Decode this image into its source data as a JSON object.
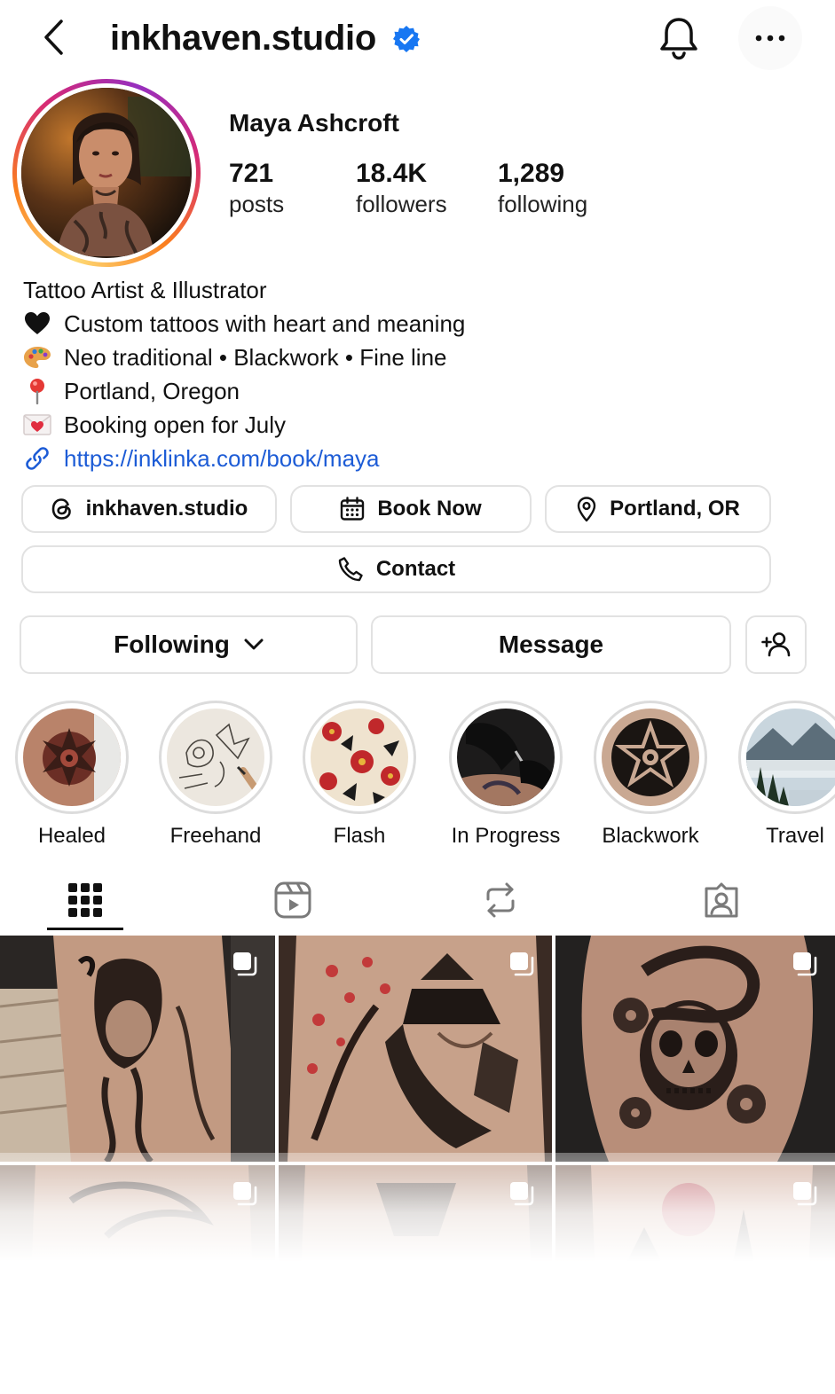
{
  "header": {
    "handle": "inkhaven.studio",
    "verified": true,
    "icons": [
      "back-arrow-icon",
      "verified-badge-icon",
      "bell-icon",
      "more-horizontal-icon"
    ]
  },
  "profile": {
    "display_name": "Maya Ashcroft",
    "stats": [
      {
        "value": "721",
        "label": "posts"
      },
      {
        "value": "18.4K",
        "label": "followers"
      },
      {
        "value": "1,289",
        "label": "following"
      }
    ]
  },
  "bio": {
    "title": "Tattoo Artist & Illustrator",
    "lines": [
      {
        "icon": "black-heart-icon",
        "text": "Custom tattoos with heart and meaning"
      },
      {
        "icon": "palette-icon",
        "text": "Neo traditional • Blackwork • Fine line"
      },
      {
        "icon": "pin-icon",
        "text": "Portland, Oregon"
      },
      {
        "icon": "love-letter-icon",
        "text": "Booking open for July"
      }
    ],
    "link": "https://inklinka.com/book/maya"
  },
  "chips": {
    "threads": "inkhaven.studio",
    "book": "Book Now",
    "location": "Portland, OR",
    "contact": "Contact"
  },
  "actions": {
    "following": "Following",
    "message": "Message"
  },
  "highlights": [
    {
      "label": "Healed"
    },
    {
      "label": "Freehand"
    },
    {
      "label": "Flash"
    },
    {
      "label": "In Progress"
    },
    {
      "label": "Blackwork"
    },
    {
      "label": "Travel"
    }
  ],
  "tabs": [
    "grid-icon",
    "reels-icon",
    "reposts-icon",
    "tagged-icon"
  ],
  "colors": {
    "link": "#1d5cd6",
    "verified": "#1877f2",
    "border": "#e2e2e2"
  }
}
